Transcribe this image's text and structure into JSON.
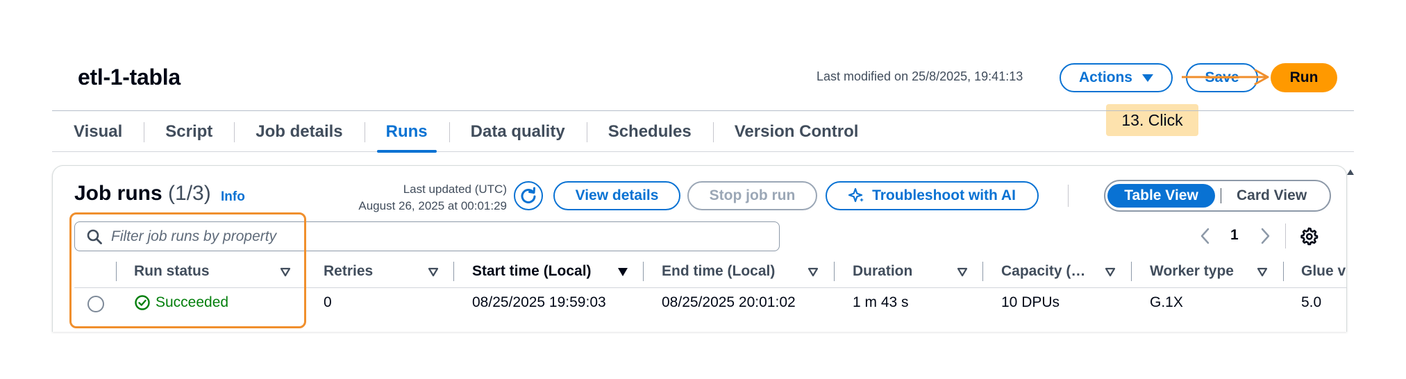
{
  "header": {
    "job_name": "etl-1-tabla",
    "last_modified": "Last modified on 25/8/2025, 19:41:13",
    "actions_label": "Actions",
    "save_label": "Save",
    "run_label": "Run"
  },
  "annotation": {
    "callout": "13. Click",
    "accent_color": "#f08f2d"
  },
  "tabs": [
    {
      "label": "Visual",
      "active": false
    },
    {
      "label": "Script",
      "active": false
    },
    {
      "label": "Job details",
      "active": false
    },
    {
      "label": "Runs",
      "active": true
    },
    {
      "label": "Data quality",
      "active": false
    },
    {
      "label": "Schedules",
      "active": false
    },
    {
      "label": "Version Control",
      "active": false
    }
  ],
  "job_runs": {
    "title": "Job runs",
    "count": "(1/3)",
    "info_label": "Info",
    "last_updated_label": "Last updated (UTC)",
    "last_updated_value": "August 26, 2025 at 00:01:29",
    "view_details_label": "View details",
    "stop_job_run_label": "Stop job run",
    "troubleshoot_label": "Troubleshoot with AI",
    "view_toggle": {
      "active": "Table View",
      "inactive": "Card View"
    },
    "filter_placeholder": "Filter job runs by property",
    "pagination": {
      "current_page": "1"
    },
    "columns": [
      "Run status",
      "Retries",
      "Start time (Local)",
      "End time (Local)",
      "Duration",
      "Capacity (…",
      "Worker type",
      "Glue v"
    ],
    "rows": [
      {
        "run_status": "Succeeded",
        "retries": "0",
        "start_time": "08/25/2025 19:59:03",
        "end_time": "08/25/2025 20:01:02",
        "duration": "1 m 43 s",
        "capacity": "10 DPUs",
        "worker_type": "G.1X",
        "glue_version": "5.0"
      }
    ]
  },
  "colors": {
    "primary_blue": "#0972d3",
    "run_orange": "#ff9900",
    "success_green": "#037f0c",
    "callout_bg": "#fde2ad"
  }
}
